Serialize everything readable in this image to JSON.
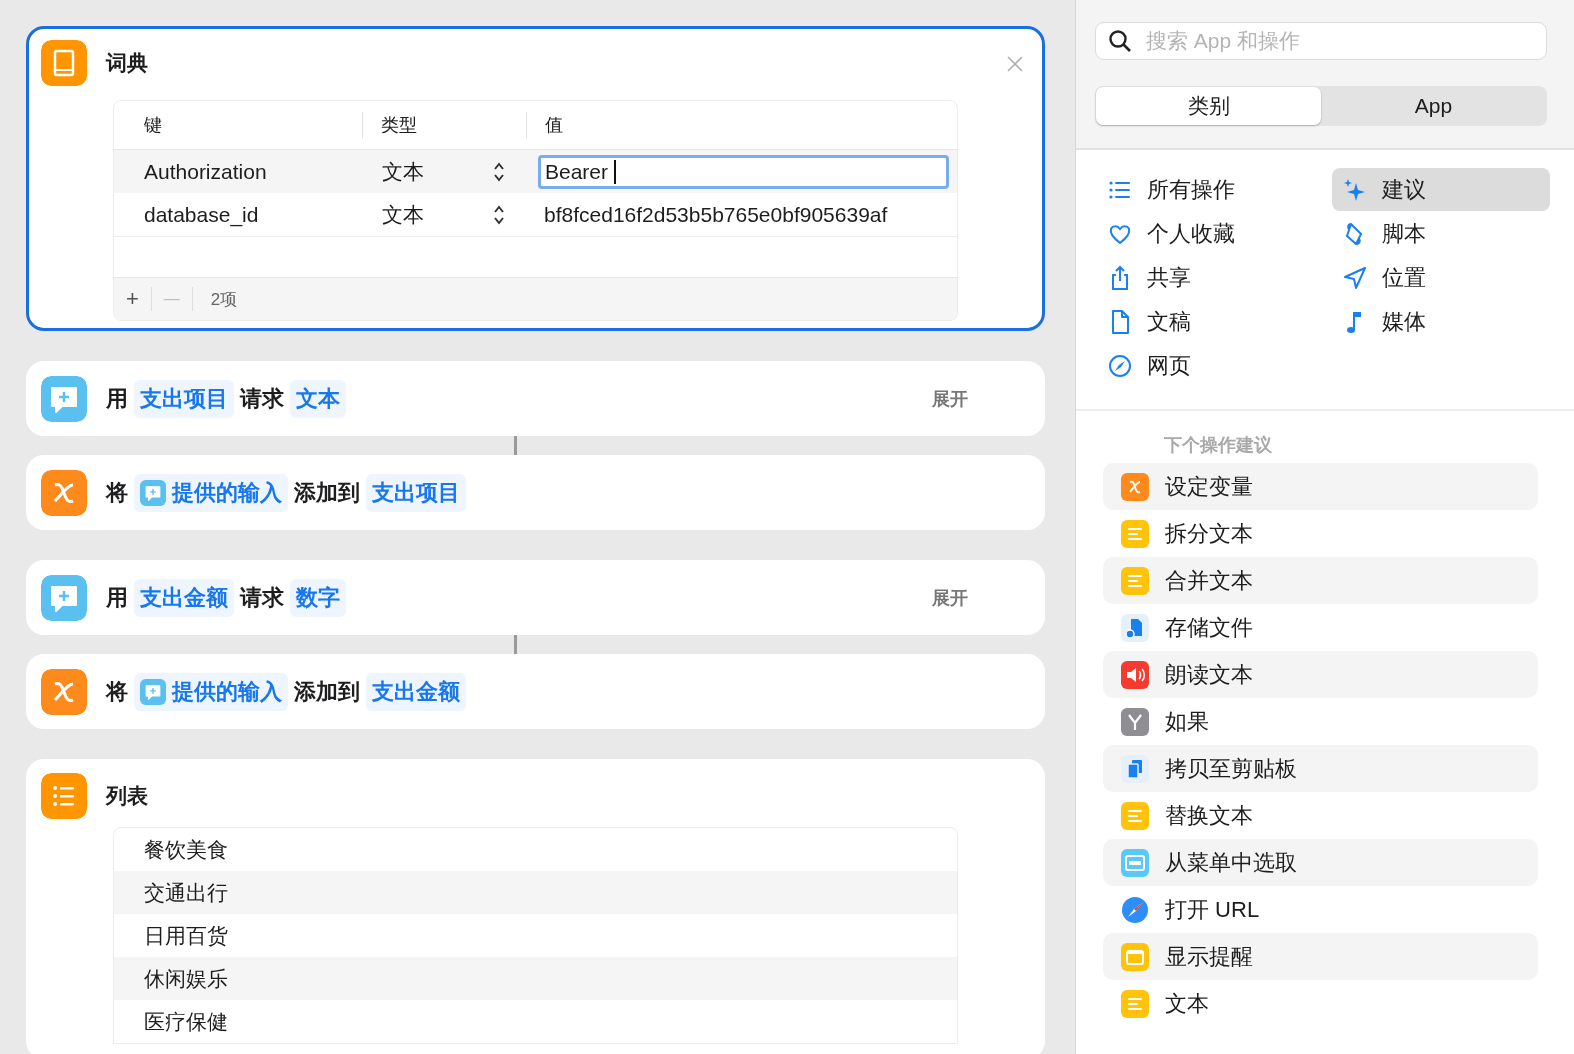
{
  "dictionary": {
    "title": "词典",
    "selected": true,
    "columns": [
      "键",
      "类型",
      "值"
    ],
    "rows": [
      {
        "key": "Authorization",
        "type": "文本",
        "value": "Bearer ",
        "editing": true
      },
      {
        "key": "database_id",
        "type": "文本",
        "value": "bf8fced16f2d53b5b765e0bf905639af",
        "editing": false
      }
    ],
    "add": "+",
    "remove": "—",
    "count": "2项"
  },
  "actions": [
    {
      "kind": "ask",
      "connected_to_next": true,
      "expand": "展开",
      "parts": [
        {
          "kind": "word",
          "text": "用"
        },
        {
          "kind": "token",
          "text": "支出项目"
        },
        {
          "kind": "word",
          "text": "请求"
        },
        {
          "kind": "token",
          "text": "文本"
        }
      ]
    },
    {
      "kind": "variable",
      "connected_to_next": false,
      "parts": [
        {
          "kind": "word",
          "text": "将"
        },
        {
          "kind": "input-token",
          "text": "提供的输入"
        },
        {
          "kind": "word",
          "text": "添加到"
        },
        {
          "kind": "token",
          "text": "支出项目"
        }
      ]
    },
    {
      "kind": "ask",
      "connected_to_next": true,
      "expand": "展开",
      "parts": [
        {
          "kind": "word",
          "text": "用"
        },
        {
          "kind": "token",
          "text": "支出金额"
        },
        {
          "kind": "word",
          "text": "请求"
        },
        {
          "kind": "token",
          "text": "数字"
        }
      ]
    },
    {
      "kind": "variable",
      "connected_to_next": false,
      "parts": [
        {
          "kind": "word",
          "text": "将"
        },
        {
          "kind": "input-token",
          "text": "提供的输入"
        },
        {
          "kind": "word",
          "text": "添加到"
        },
        {
          "kind": "token",
          "text": "支出金额"
        }
      ]
    }
  ],
  "list": {
    "title": "列表",
    "items": [
      "餐饮美食",
      "交通出行",
      "日用百货",
      "休闲娱乐",
      "医疗保健"
    ]
  },
  "sidebar": {
    "search": {
      "placeholder": "搜索 App 和操作"
    },
    "segments": [
      {
        "label": "类别",
        "selected": true
      },
      {
        "label": "App",
        "selected": false
      }
    ],
    "categories": [
      {
        "label": "所有操作",
        "kind": "list",
        "selected": false
      },
      {
        "label": "建议",
        "kind": "sparkle",
        "selected": true
      },
      {
        "label": "个人收藏",
        "kind": "heart",
        "selected": false
      },
      {
        "label": "脚本",
        "kind": "script",
        "selected": false
      },
      {
        "label": "共享",
        "kind": "share",
        "selected": false
      },
      {
        "label": "位置",
        "kind": "location",
        "selected": false
      },
      {
        "label": "文稿",
        "kind": "document",
        "selected": false
      },
      {
        "label": "媒体",
        "kind": "music",
        "selected": false
      },
      {
        "label": "网页",
        "kind": "compass",
        "selected": false
      }
    ],
    "suggestions_heading": "下个操作建议",
    "suggestions": [
      {
        "label": "设定变量",
        "kind": "variable"
      },
      {
        "label": "拆分文本",
        "kind": "text"
      },
      {
        "label": "合并文本",
        "kind": "text"
      },
      {
        "label": "存储文件",
        "kind": "file"
      },
      {
        "label": "朗读文本",
        "kind": "speaker"
      },
      {
        "label": "如果",
        "kind": "branch"
      },
      {
        "label": "拷贝至剪贴板",
        "kind": "clipboard"
      },
      {
        "label": "替换文本",
        "kind": "text"
      },
      {
        "label": "从菜单中选取",
        "kind": "menu"
      },
      {
        "label": "打开 URL",
        "kind": "safari"
      },
      {
        "label": "显示提醒",
        "kind": "alert"
      },
      {
        "label": "文本",
        "kind": "text"
      }
    ]
  }
}
